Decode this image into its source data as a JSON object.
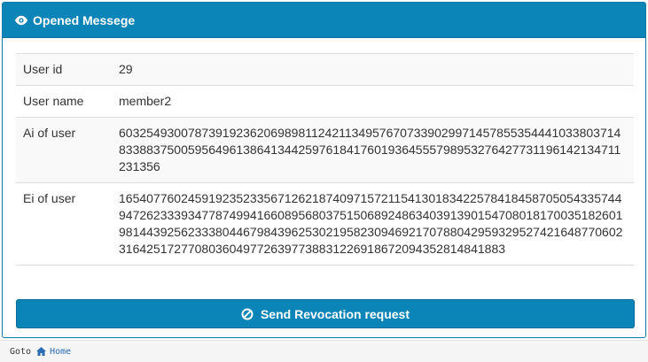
{
  "panel": {
    "title": "Opened Messege",
    "icon": "eye-icon"
  },
  "rows": [
    {
      "label": "User id",
      "value": "29"
    },
    {
      "label": "User name",
      "value": "member2"
    },
    {
      "label": "Ai of user",
      "value": "60325493007873919236206989811242113495767073390299714578553544410338037148338837500595649613864134425976184176019364555798953276427731196142134711231356"
    },
    {
      "label": "Ei of user",
      "value": "16540776024591923523356712621874097157211541301834225784184587050543357449472623339347787499416608956803751506892486340391390154708018170035182601981443925623338044679843962530219582309469217078804295932952742164877060231642517277080360497726397738831226918672094352814841883"
    }
  ],
  "button": {
    "label": "Send Revocation request",
    "icon": "ban-icon"
  },
  "footer": {
    "goto": "Goto",
    "home": "Home",
    "icon": "home-icon"
  },
  "colors": {
    "primary": "#0b84b8",
    "link": "#2a6db0"
  }
}
